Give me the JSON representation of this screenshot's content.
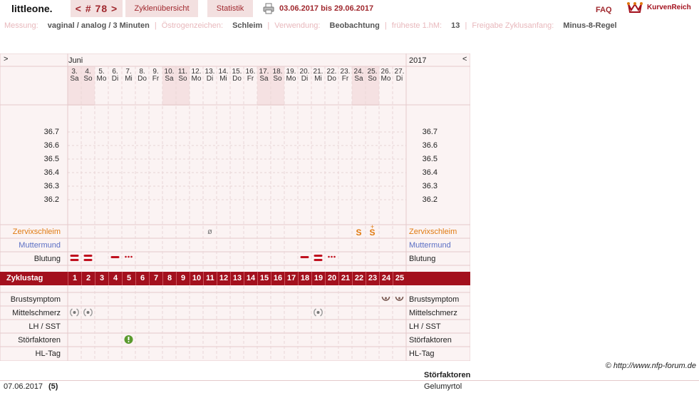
{
  "header": {
    "username": "littleone.",
    "cycle_prev": "<",
    "cycle_label": "# 78",
    "cycle_next": ">",
    "tab_overview": "Zyklenübersicht",
    "tab_stats": "Statistik",
    "date_range": "03.06.2017 bis 29.06.2017",
    "faq": "FAQ",
    "brand": "KurvenReich",
    "print_icon": "printer-icon"
  },
  "info": {
    "messung_label": "Messung:",
    "messung_value": "vaginal / analog / 3 Minuten",
    "oestrogen_label": "Östrogenzeichen:",
    "oestrogen_value": "Schleim",
    "verwendung_label": "Verwendung:",
    "verwendung_value": "Beobachtung",
    "fruehest_label": "früheste 1.hM:",
    "fruehest_value": "13",
    "freigabe_label": "Freigabe Zyklusanfang:",
    "freigabe_value": "Minus-8-Regel"
  },
  "chart": {
    "nav_left": ">",
    "nav_right": "<",
    "month": "Juni",
    "year": "2017",
    "days": [
      {
        "d": "3.",
        "w": "Sa",
        "weekend": true
      },
      {
        "d": "4.",
        "w": "So",
        "weekend": true
      },
      {
        "d": "5.",
        "w": "Mo",
        "weekend": false
      },
      {
        "d": "6.",
        "w": "Di",
        "weekend": false
      },
      {
        "d": "7.",
        "w": "Mi",
        "weekend": false
      },
      {
        "d": "8.",
        "w": "Do",
        "weekend": false
      },
      {
        "d": "9.",
        "w": "Fr",
        "weekend": false
      },
      {
        "d": "10.",
        "w": "Sa",
        "weekend": true
      },
      {
        "d": "11.",
        "w": "So",
        "weekend": true
      },
      {
        "d": "12.",
        "w": "Mo",
        "weekend": false
      },
      {
        "d": "13.",
        "w": "Di",
        "weekend": false
      },
      {
        "d": "14.",
        "w": "Mi",
        "weekend": false
      },
      {
        "d": "15.",
        "w": "Do",
        "weekend": false
      },
      {
        "d": "16.",
        "w": "Fr",
        "weekend": false
      },
      {
        "d": "17.",
        "w": "Sa",
        "weekend": true
      },
      {
        "d": "18.",
        "w": "So",
        "weekend": true
      },
      {
        "d": "19.",
        "w": "Mo",
        "weekend": false
      },
      {
        "d": "20.",
        "w": "Di",
        "weekend": false
      },
      {
        "d": "21.",
        "w": "Mi",
        "weekend": false
      },
      {
        "d": "22.",
        "w": "Do",
        "weekend": false
      },
      {
        "d": "23.",
        "w": "Fr",
        "weekend": false
      },
      {
        "d": "24.",
        "w": "Sa",
        "weekend": true
      },
      {
        "d": "25.",
        "w": "So",
        "weekend": true
      },
      {
        "d": "26.",
        "w": "Mo",
        "weekend": false
      },
      {
        "d": "27.",
        "w": "Di",
        "weekend": false
      }
    ],
    "temps": [
      "36.7",
      "36.6",
      "36.5",
      "36.4",
      "36.3",
      "36.2"
    ],
    "rows": {
      "zervix": "Zervixschleim",
      "muttermund": "Muttermund",
      "blutung": "Blutung",
      "zyklustag": "Zyklustag",
      "brust": "Brustsymptom",
      "mittel": "Mittelschmerz",
      "lh": "LH / SST",
      "stoer": "Störfaktoren",
      "hl": "HL-Tag"
    },
    "cycle_days": [
      "1",
      "2",
      "3",
      "4",
      "5",
      "6",
      "7",
      "8",
      "9",
      "10",
      "11",
      "12",
      "13",
      "14",
      "15",
      "16",
      "17",
      "18",
      "19",
      "20",
      "21",
      "22",
      "23",
      "24",
      "25"
    ],
    "zervix_marks": [
      {
        "day": 11,
        "symbol": "ø"
      },
      {
        "day": 22,
        "symbol": "S"
      },
      {
        "day": 23,
        "symbol": "S+"
      }
    ],
    "blutung_marks": [
      {
        "day": 1,
        "kind": "stark"
      },
      {
        "day": 2,
        "kind": "stark"
      },
      {
        "day": 4,
        "kind": "normal"
      },
      {
        "day": 5,
        "kind": "schmier"
      },
      {
        "day": 18,
        "kind": "normal"
      },
      {
        "day": 19,
        "kind": "stark"
      },
      {
        "day": 20,
        "kind": "schmier"
      }
    ],
    "brust_marks": [
      24,
      25
    ],
    "mittel_marks": [
      1,
      2,
      19
    ],
    "stoer_marks": [
      5
    ],
    "colors": {
      "accent": "#a3101d",
      "zervix": "#e07a10",
      "muttermund": "#5b6fc4",
      "grid": "#e4c9cb",
      "weekend": "#f5e1e2",
      "bg": "#fbf3f3",
      "stoer": "#5a9a2e"
    }
  },
  "notes": {
    "copyright": "© http://www.nfp-forum.de",
    "stoer_header": "Störfaktoren",
    "date": "07.06.2017",
    "count": "(5)",
    "text": "Gelumyrtol"
  }
}
